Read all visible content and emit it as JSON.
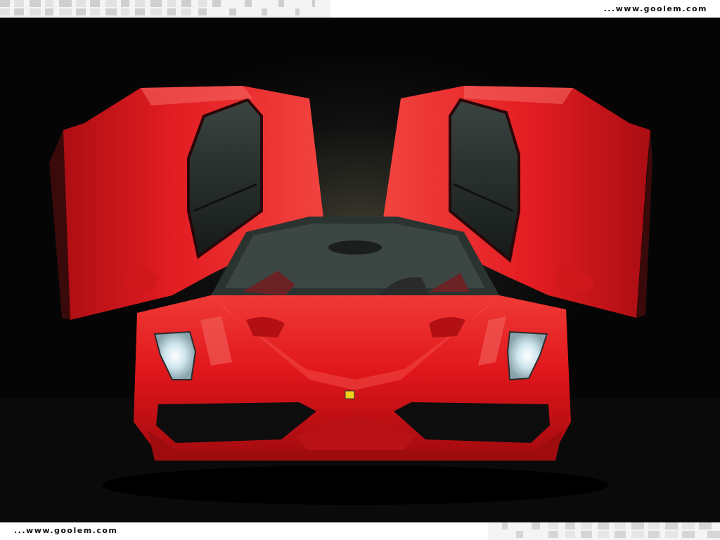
{
  "header": {
    "site_text": "...www.goolem.com"
  },
  "footer": {
    "site_text": "...www.goolem.com"
  },
  "photo": {
    "subject": "red-sports-car-front-view-doors-open",
    "colors": {
      "body": "#e0161b",
      "background": "#050505",
      "glass": "#1d2320",
      "headlight": "#d8ecf2"
    }
  }
}
